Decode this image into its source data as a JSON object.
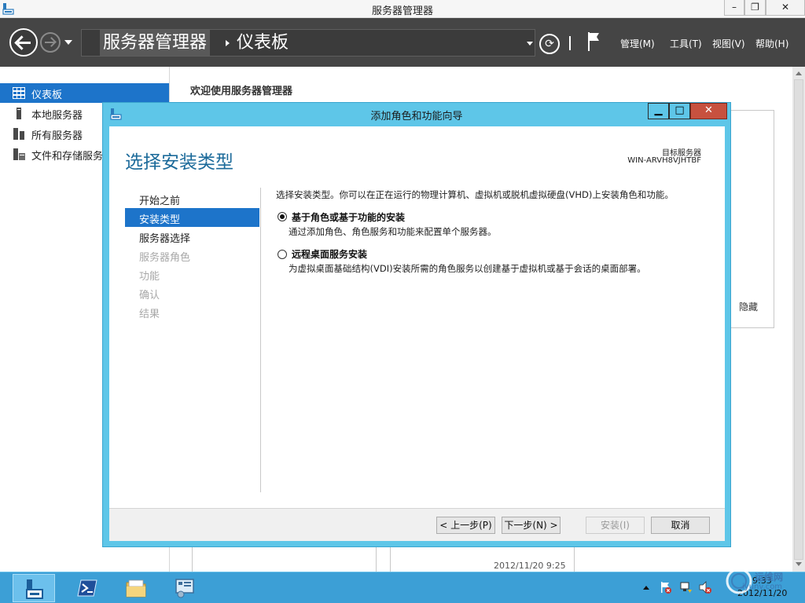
{
  "window": {
    "title": "服务器管理器",
    "min_label": "–",
    "max_label": "❐",
    "close_label": "✕"
  },
  "navbar": {
    "breadcrumb_root": "服务器管理器",
    "breadcrumb_current": "仪表板",
    "refresh_glyph": "⟳",
    "menus": {
      "manage": "管理(M)",
      "tools": "工具(T)",
      "view": "视图(V)",
      "help": "帮助(H)"
    }
  },
  "sidebar": {
    "items": [
      {
        "label": "仪表板",
        "icon": "dashboard-icon",
        "active": true
      },
      {
        "label": "本地服务器",
        "icon": "server-icon",
        "active": false
      },
      {
        "label": "所有服务器",
        "icon": "servers-icon",
        "active": false
      },
      {
        "label": "文件和存储服务",
        "icon": "storage-icon",
        "active": false
      }
    ]
  },
  "main": {
    "welcome": "欢迎使用服务器管理器",
    "hide_link": "隐藏",
    "timestamp": "2012/11/20 9:25"
  },
  "dialog": {
    "title": "添加角色和功能向导",
    "min_label": "▁",
    "max_label": "□",
    "close_label": "✕",
    "heading": "选择安装类型",
    "dest_label": "目标服务器",
    "dest_server": "WIN-ARVH8VJHTBF",
    "steps": [
      {
        "label": "开始之前",
        "state": "enabled"
      },
      {
        "label": "安装类型",
        "state": "active"
      },
      {
        "label": "服务器选择",
        "state": "enabled"
      },
      {
        "label": "服务器角色",
        "state": "disabled"
      },
      {
        "label": "功能",
        "state": "disabled"
      },
      {
        "label": "确认",
        "state": "disabled"
      },
      {
        "label": "结果",
        "state": "disabled"
      }
    ],
    "intro": "选择安装类型。你可以在正在运行的物理计算机、虚拟机或脱机虚拟硬盘(VHD)上安装角色和功能。",
    "options": [
      {
        "title": "基于角色或基于功能的安装",
        "desc": "通过添加角色、角色服务和功能来配置单个服务器。",
        "selected": true
      },
      {
        "title": "远程桌面服务安装",
        "desc": "为虚拟桌面基础结构(VDI)安装所需的角色服务以创建基于虚拟机或基于会话的桌面部署。",
        "selected": false
      }
    ],
    "buttons": {
      "prev": "< 上一步(P)",
      "next": "下一步(N) >",
      "install": "安装(I)",
      "cancel": "取消"
    }
  },
  "taskbar": {
    "items": [
      "server-manager",
      "powershell",
      "file-explorer",
      "control-panel"
    ],
    "time": "9:33",
    "date": "2012/11/20",
    "watermark_text": "运维网",
    "watermark_url": "iyunv.com"
  },
  "colors": {
    "accent": "#1d74ca",
    "dialog_frame": "#5ec6e8",
    "navbar": "#454545",
    "taskbar": "#3c9fd6",
    "close_red": "#c7513f"
  }
}
